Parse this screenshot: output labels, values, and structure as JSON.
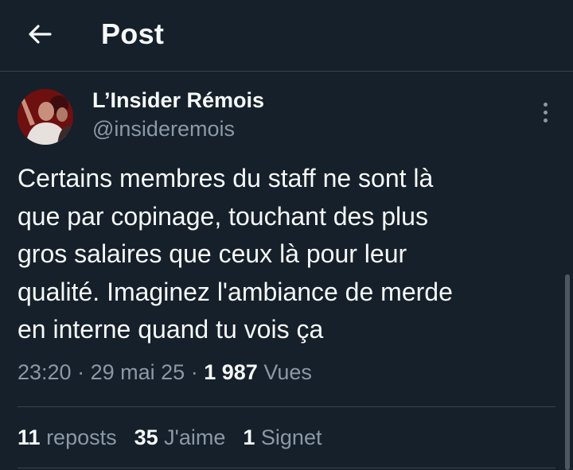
{
  "header": {
    "title": "Post",
    "back_icon": "arrow-left-icon"
  },
  "author": {
    "display_name": "L’Insider Rémois",
    "handle": "@insideremois",
    "avatar_desc": "profile photo"
  },
  "post": {
    "text": "Certains membres du staff ne sont là\nque par copinage, touchant des plus\ngros salaires que ceux là pour leur\nqualité. Imaginez l'ambiance de merde\nen interne quand tu vois ça",
    "time": "23:20",
    "separator": "·",
    "date": "29 mai 25",
    "views_count": "1 987",
    "views_label": "Vues"
  },
  "stats": {
    "reposts_count": "11",
    "reposts_label": "reposts",
    "likes_count": "35",
    "likes_label": "J'aime",
    "bookmarks_count": "1",
    "bookmarks_label": "Signet"
  },
  "colors": {
    "background": "#15202b",
    "primary_text": "#f7f9f9",
    "secondary_text": "#8b98a5",
    "divider": "#38444d"
  }
}
